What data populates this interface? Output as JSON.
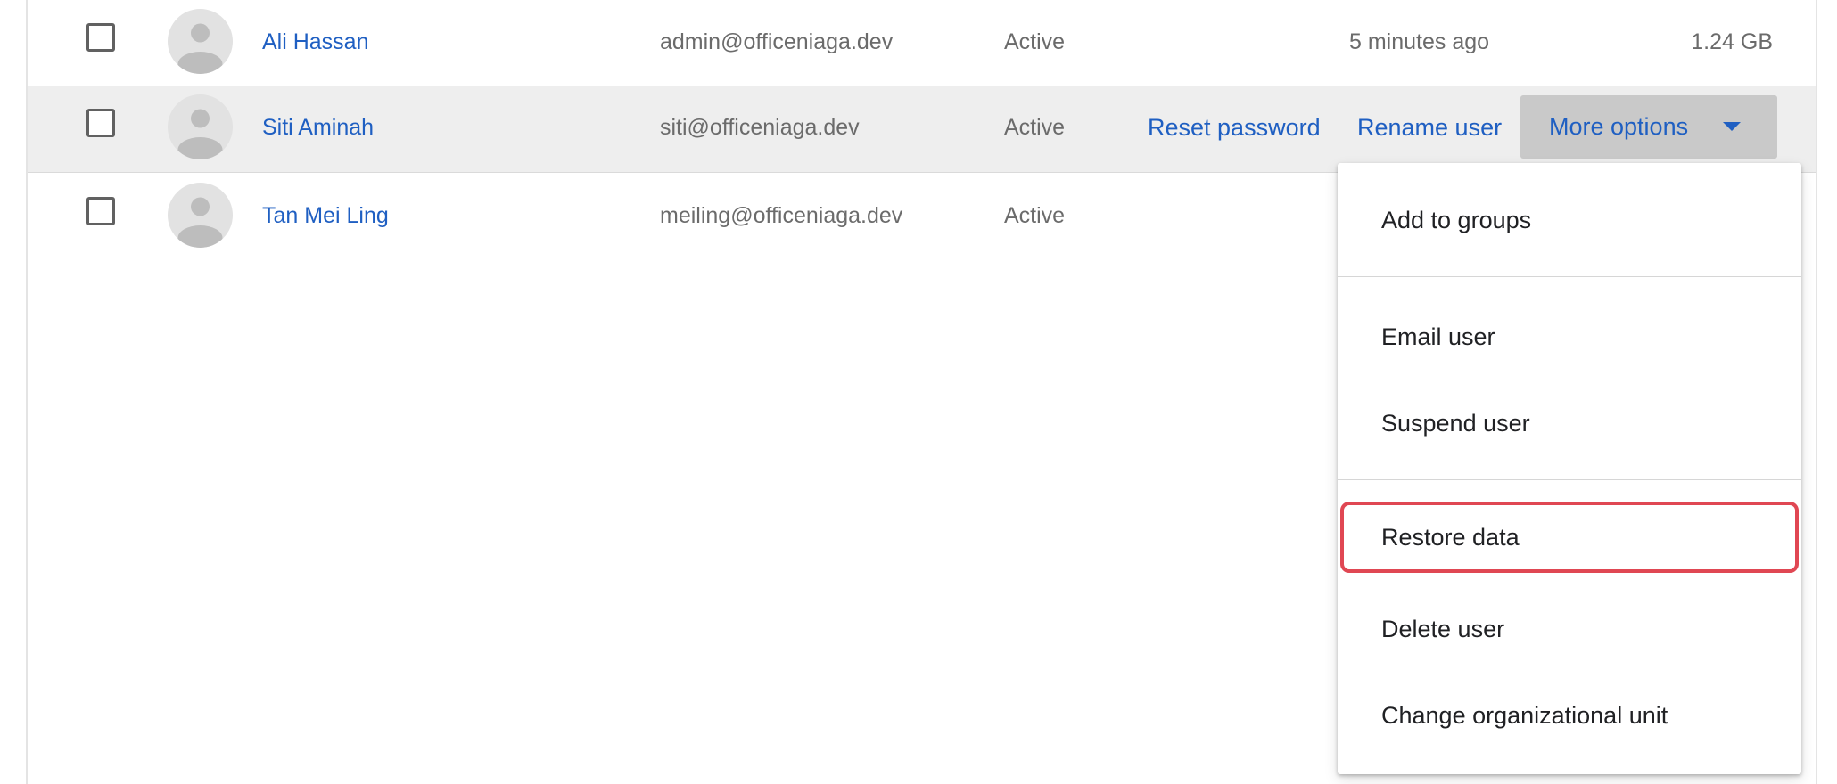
{
  "users": [
    {
      "name": "Ali Hassan",
      "email": "admin@officeniaga.dev",
      "status": "Active",
      "last_sign_in": "5 minutes ago",
      "storage": "1.24 GB"
    },
    {
      "name": "Siti Aminah",
      "email": "siti@officeniaga.dev",
      "status": "Active"
    },
    {
      "name": "Tan Mei Ling",
      "email": "meiling@officeniaga.dev",
      "status": "Active"
    }
  ],
  "row_actions": {
    "reset_password": "Reset password",
    "rename_user": "Rename user",
    "more_options": "More options"
  },
  "menu": {
    "items": [
      "Add to groups",
      "Email user",
      "Suspend user",
      "Restore data",
      "Delete user",
      "Change organizational unit"
    ],
    "highlighted": "Restore data"
  },
  "colors": {
    "link": "#1f5fc2",
    "highlight_border": "#e04753",
    "hover_row": "#eeeeee"
  },
  "icons": [
    "checkbox-icon",
    "avatar-placeholder-icon",
    "caret-down-icon"
  ]
}
